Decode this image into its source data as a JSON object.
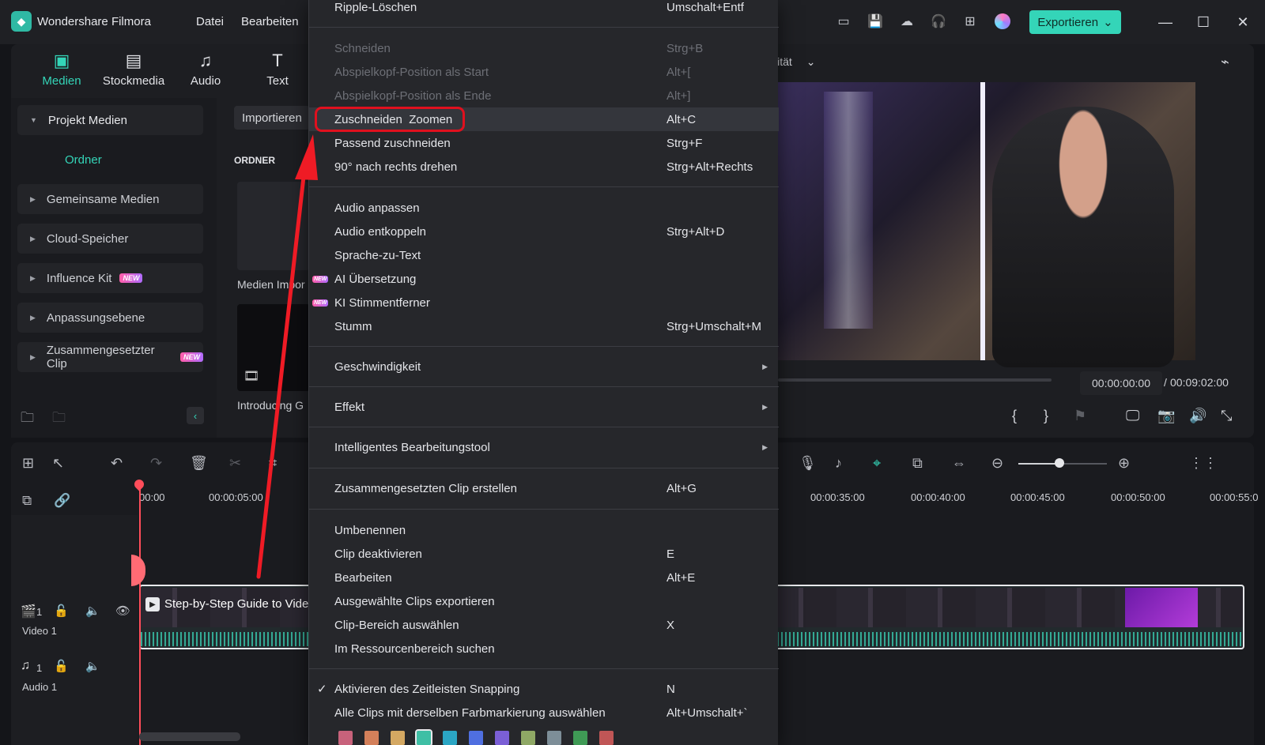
{
  "app": {
    "title": "Wondershare Filmora",
    "menu": [
      "Datei",
      "Bearbeiten"
    ],
    "export_label": "Exportieren"
  },
  "media_categories": [
    {
      "label": "Medien",
      "icon": "media-icon"
    },
    {
      "label": "Stockmedia",
      "icon": "stock-media-icon"
    },
    {
      "label": "Audio",
      "icon": "music-note-icon"
    },
    {
      "label": "Text",
      "icon": "text-icon"
    }
  ],
  "sidebar": {
    "items": [
      {
        "label": "Projekt Medien"
      },
      {
        "label": "Gemeinsame Medien"
      },
      {
        "label": "Cloud-Speicher"
      },
      {
        "label": "Influence Kit",
        "badge": "NEW"
      },
      {
        "label": "Anpassungsebene"
      },
      {
        "label": "Zusammengesetzter Clip",
        "badge": "NEW"
      }
    ],
    "folder": "Ordner"
  },
  "media_panel": {
    "import_label": "Importieren",
    "section_label": "ORDNER",
    "thumbs": [
      {
        "caption": "Medien Impor"
      },
      {
        "caption": "Introducing G"
      }
    ]
  },
  "preview": {
    "quality_label": "lität",
    "timecode": "00:00:00:00",
    "separator": "/",
    "duration": "00:09:02:00"
  },
  "timeline": {
    "ruler_labels": [
      "00:00",
      "00:00:05:00",
      "00:00:35:00",
      "00:00:40:00",
      "00:00:45:00",
      "00:00:50:00",
      "00:00:55:0"
    ],
    "clip_title": "Step-by-Step Guide to Vide",
    "video_track": {
      "number": "1",
      "label": "Video 1"
    },
    "audio_track": {
      "number": "1",
      "label": "Audio 1"
    }
  },
  "context_menu": {
    "items": [
      {
        "label": "Ripple-Löschen",
        "shortcut": "Umschalt+Entf"
      },
      {
        "label": "Schneiden",
        "shortcut": "Strg+B",
        "disabled": true
      },
      {
        "label": "Abspielkopf-Position als Start",
        "shortcut": "Alt+[",
        "disabled": true
      },
      {
        "label": "Abspielkopf-Position als Ende",
        "shortcut": "Alt+]",
        "disabled": true
      },
      {
        "label": "Zuschneiden  Zoomen",
        "shortcut": "Alt+C",
        "highlighted": true
      },
      {
        "label": "Passend zuschneiden",
        "shortcut": "Strg+F"
      },
      {
        "label": "90° nach rechts drehen",
        "shortcut": "Strg+Alt+Rechts"
      },
      {
        "label": "Audio anpassen",
        "shortcut": ""
      },
      {
        "label": "Audio entkoppeln",
        "shortcut": "Strg+Alt+D"
      },
      {
        "label": "Sprache-zu-Text",
        "shortcut": ""
      },
      {
        "label": "AI Übersetzung",
        "shortcut": "",
        "badge": "NEW"
      },
      {
        "label": "KI Stimmentferner",
        "shortcut": "",
        "badge": "NEW"
      },
      {
        "label": "Stumm",
        "shortcut": "Strg+Umschalt+M"
      },
      {
        "label": "Geschwindigkeit",
        "shortcut": "",
        "submenu": true
      },
      {
        "label": "Effekt",
        "shortcut": "",
        "submenu": true
      },
      {
        "label": "Intelligentes Bearbeitungstool",
        "shortcut": "",
        "submenu": true
      },
      {
        "label": "Zusammengesetzten Clip erstellen",
        "shortcut": "Alt+G"
      },
      {
        "label": "Umbenennen",
        "shortcut": ""
      },
      {
        "label": "Clip deaktivieren",
        "shortcut": "E"
      },
      {
        "label": "Bearbeiten",
        "shortcut": "Alt+E"
      },
      {
        "label": "Ausgewählte Clips exportieren",
        "shortcut": ""
      },
      {
        "label": "Clip-Bereich auswählen",
        "shortcut": "X"
      },
      {
        "label": "Im Ressourcenbereich suchen",
        "shortcut": ""
      },
      {
        "label": "Aktivieren des Zeitleisten Snapping",
        "shortcut": "N",
        "checked": true
      },
      {
        "label": "Alle Clips mit derselben Farbmarkierung auswählen",
        "shortcut": "Alt+Umschalt+`"
      }
    ],
    "color_swatches": [
      "#c8627b",
      "#d4805a",
      "#d4a862",
      "#3fbfa5",
      "#2ba6c4",
      "#4f6fe0",
      "#7b5fd6",
      "#8fa865",
      "#7d8e98",
      "#3f9a55",
      "#c05656"
    ]
  },
  "colors": {
    "accent": "#34d5b8",
    "highlight_ring": "#e0101e",
    "playhead": "#ff4d5a"
  }
}
